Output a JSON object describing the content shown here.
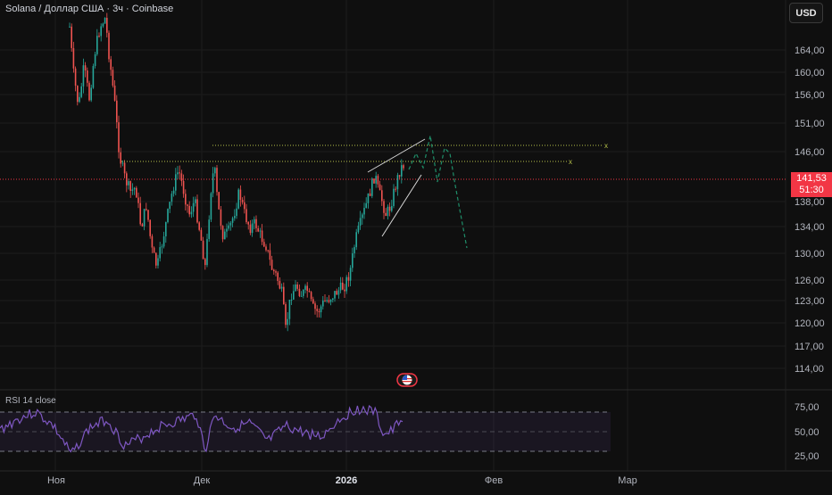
{
  "header": {
    "title": "Solana / Доллар США · 3ч · Coinbase",
    "currency_button": "USD"
  },
  "price_tag": {
    "price": "141,53",
    "countdown": "51:30",
    "color": "#f23645"
  },
  "price_axis": [
    "164,00",
    "160,00",
    "156,00",
    "151,00",
    "146,00",
    "142,00",
    "138,00",
    "134,00",
    "130,00",
    "126,00",
    "123,00",
    "120,00",
    "117,00",
    "114,00"
  ],
  "rsi": {
    "label": "RSI 14 close",
    "axis": [
      "75,00",
      "50,00",
      "25,00"
    ]
  },
  "time_axis": [
    {
      "label": "Ноя",
      "bold": false
    },
    {
      "label": "Дек",
      "bold": false
    },
    {
      "label": "2026",
      "bold": true
    },
    {
      "label": "Фев",
      "bold": false
    },
    {
      "label": "Мар",
      "bold": false
    }
  ],
  "colors": {
    "up": "#26a69a",
    "down": "#ef5350",
    "rsi": "#7e57c2",
    "projection": "#1f8f6a",
    "level": "#b6c24a"
  },
  "icons": {
    "events": "us-flag-icon"
  }
}
